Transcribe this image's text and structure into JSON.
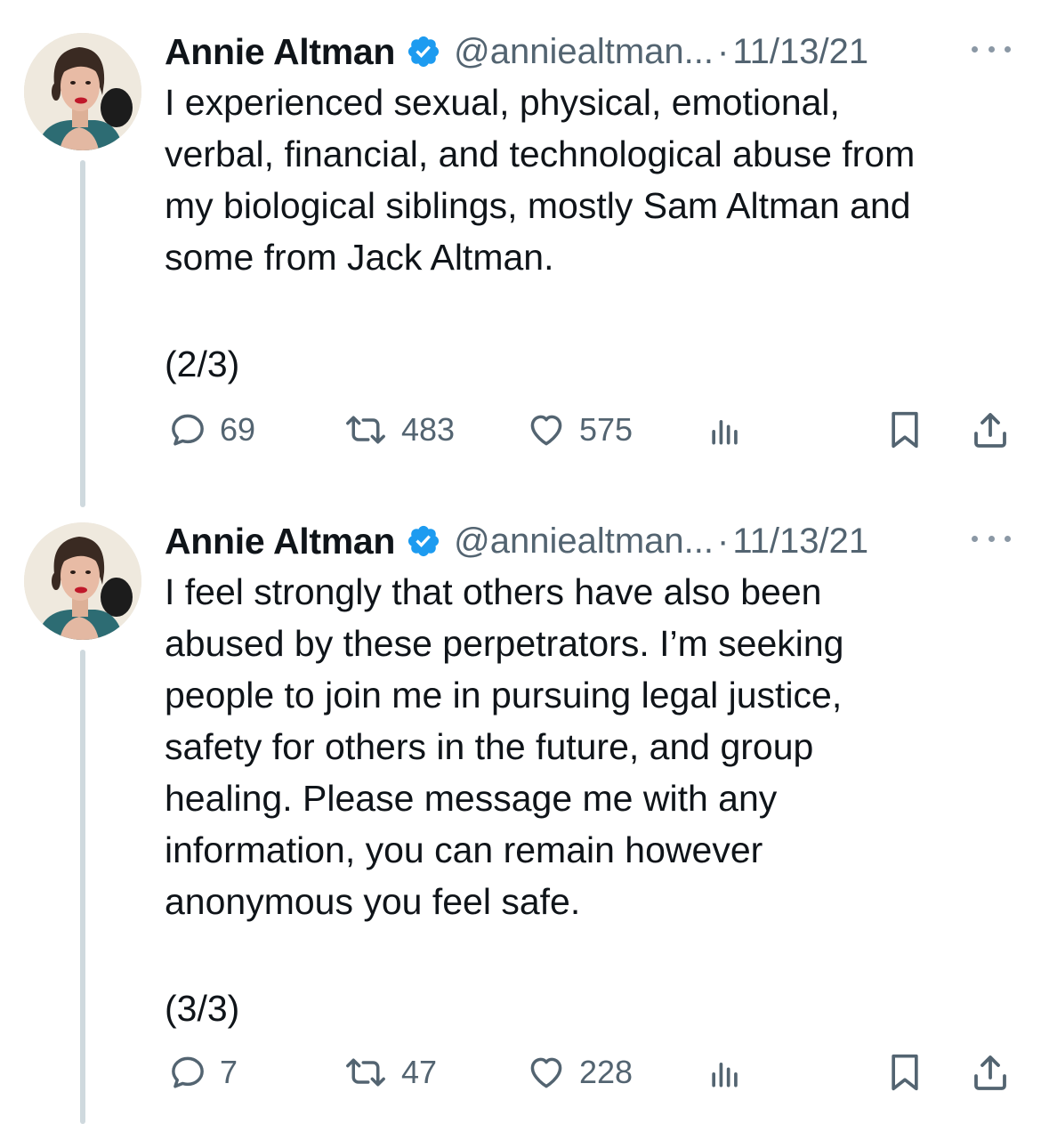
{
  "colors": {
    "text": "#0f1419",
    "muted": "#536471",
    "verified": "#1d9bf0",
    "thread_line": "#cfd9de"
  },
  "tweets": [
    {
      "author_name": "Annie Altman",
      "handle": "@anniealtman...",
      "separator": "·",
      "date": "11/13/21",
      "text": "I experienced sexual, physical, emotional,\nverbal, financial, and technological abuse from\nmy biological siblings, mostly Sam Altman and\nsome from Jack Altman.",
      "part": "(2/3)",
      "replies": "69",
      "retweets": "483",
      "likes": "575"
    },
    {
      "author_name": "Annie Altman",
      "handle": "@anniealtman...",
      "separator": "·",
      "date": "11/13/21",
      "text": "I feel strongly that others have also been\nabused by these perpetrators. I’m seeking\npeople to join me in pursuing legal justice,\nsafety for others in the future, and group\nhealing. Please message me with any\ninformation, you can remain however\nanonymous you feel safe.",
      "part": "(3/3)",
      "replies": "7",
      "retweets": "47",
      "likes": "228"
    }
  ],
  "icons": {
    "verified": "verified-badge-icon",
    "more": "more-options-icon",
    "reply": "reply-icon",
    "retweet": "retweet-icon",
    "like": "like-icon",
    "views": "views-icon",
    "bookmark": "bookmark-icon",
    "share": "share-icon"
  }
}
